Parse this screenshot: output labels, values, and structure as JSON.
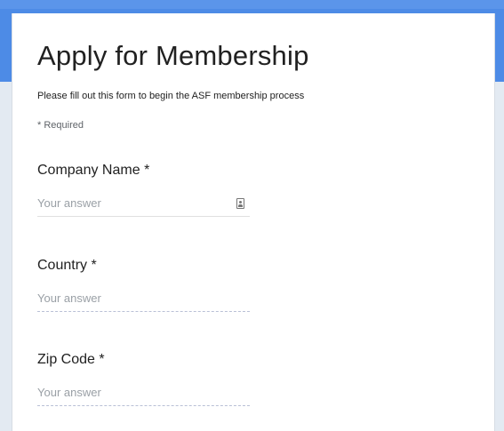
{
  "form": {
    "title": "Apply for Membership",
    "description": "Please fill out this form to begin the ASF membership process",
    "required_note": "* Required",
    "questions": [
      {
        "label": "Company Name",
        "required_marker": "*",
        "placeholder": "Your answer",
        "value": ""
      },
      {
        "label": "Country",
        "required_marker": "*",
        "placeholder": "Your answer",
        "value": ""
      },
      {
        "label": "Zip Code",
        "required_marker": "*",
        "placeholder": "Your answer",
        "value": ""
      }
    ]
  },
  "icons": {
    "autofill": "contact-card-icon"
  },
  "colors": {
    "banner": "#4d8be6",
    "page_background": "#e3eaf2",
    "card": "#ffffff",
    "text": "#212121",
    "placeholder": "#9aa0a6"
  }
}
